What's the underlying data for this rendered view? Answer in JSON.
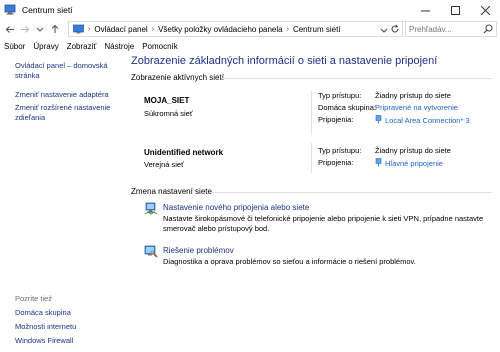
{
  "window": {
    "title": "Centrum sietí"
  },
  "address": {
    "crumbs": [
      "Ovládací panel",
      "Všetky položky ovládacieho panela",
      "Centrum sietí"
    ],
    "search_placeholder": "Prehľadáv..."
  },
  "menu": [
    "Súbor",
    "Úpravy",
    "Zobraziť",
    "Nástroje",
    "Pomocník"
  ],
  "sidebar": {
    "links": [
      "Ovládací panel – domovská stránka",
      "Zmeniť nastavenie adaptéra",
      "Zmeniť rozšírené nastavenie zdieľania"
    ],
    "see_also_label": "Pozrite tiež",
    "see_also": [
      "Domáca skupina",
      "Možnosti internetu",
      "Windows Firewall"
    ]
  },
  "main": {
    "heading": "Zobrazenie základných informácií o sieti a nastavenie pripojení",
    "active_networks_label": "Zobrazenie aktívnych sietí",
    "networks": [
      {
        "name": "MOJA_SIET",
        "type": "Súkromná sieť",
        "props": [
          {
            "label": "Typ prístupu:",
            "value": "Žiadny prístup do siete",
            "link": false
          },
          {
            "label": "Domáca skupina:",
            "value": "Pripravené na vytvorenie",
            "link": true
          },
          {
            "label": "Pripojenia:",
            "value": "Local Area Connection* 3",
            "link": true,
            "icon": "network-adapter-icon"
          }
        ]
      },
      {
        "name": "Unidentified network",
        "type": "Verejná sieť",
        "props": [
          {
            "label": "Typ prístupu:",
            "value": "Žiadny prístup do siete",
            "link": false
          },
          {
            "label": "Pripojenia:",
            "value": "Hlavné pripojenie",
            "link": true,
            "icon": "network-adapter-icon"
          }
        ]
      }
    ],
    "change_settings_label": "Zmena nastavení siete",
    "tasks": [
      {
        "icon": "new-connection-icon",
        "link": "Nastavenie nového pripojenia alebo siete",
        "desc": "Nastavte širokopásmové či telefonické pripojenie alebo pripojenie k sieti VPN, prípadne nastavte smerovač alebo prístupový bod."
      },
      {
        "icon": "troubleshoot-icon",
        "link": "Riešenie problémov",
        "desc": "Diagnostika a oprava problémov so sieťou a informácie o riešení problémov."
      }
    ]
  },
  "colors": {
    "link": "#1e3287",
    "link_blue": "#1e64c8",
    "divider": "#e3e3e3"
  }
}
